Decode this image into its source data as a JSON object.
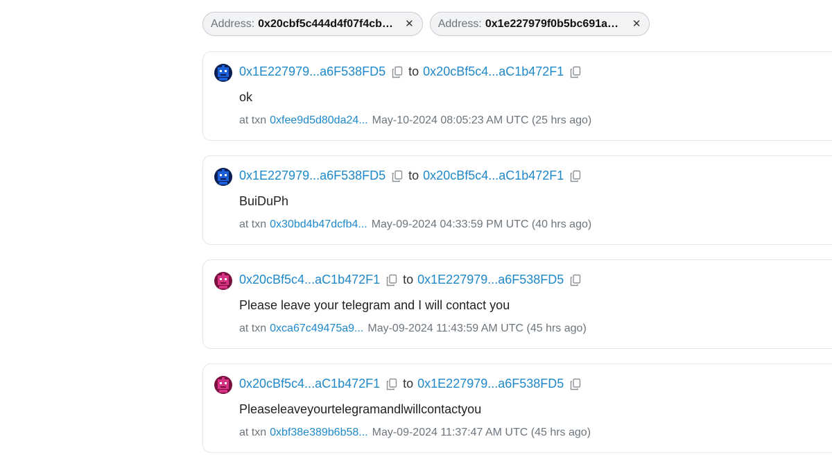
{
  "filters": [
    {
      "label": "Address:",
      "value": "0x20cbf5c444d4f07f4cb5..."
    },
    {
      "label": "Address:",
      "value": "0x1e227979f0b5bc691a7..."
    }
  ],
  "close_glyph": "✕",
  "to_label": "to",
  "txn_prefix": "at txn",
  "messages": [
    {
      "avatar": "blue-robot-avatar",
      "from": "0x1E227979...a6F538FD5",
      "to": "0x20cBf5c4...aC1b472F1",
      "text": "ok",
      "txn": "0xfee9d5d80da24...",
      "timestamp": "May-10-2024 08:05:23 AM UTC (25 hrs ago)"
    },
    {
      "avatar": "blue-robot-avatar",
      "from": "0x1E227979...a6F538FD5",
      "to": "0x20cBf5c4...aC1b472F1",
      "text": "BuiDuPh",
      "txn": "0x30bd4b47dcfb4...",
      "timestamp": "May-09-2024 04:33:59 PM UTC (40 hrs ago)"
    },
    {
      "avatar": "pink-robot-avatar",
      "from": "0x20cBf5c4...aC1b472F1",
      "to": "0x1E227979...a6F538FD5",
      "text": "Please leave your telegram and I will contact you",
      "txn": "0xca67c49475a9...",
      "timestamp": "May-09-2024 11:43:59 AM UTC (45 hrs ago)"
    },
    {
      "avatar": "pink-robot-avatar",
      "from": "0x20cBf5c4...aC1b472F1",
      "to": "0x1E227979...a6F538FD5",
      "text": "Pleaseleaveyourtelegramandlwillcontactyou",
      "txn": "0xbf38e389b6b58...",
      "timestamp": "May-09-2024 11:37:47 AM UTC (45 hrs ago)"
    }
  ],
  "colors": {
    "link": "#1e88c9",
    "muted": "#6c757d",
    "blue_avatar": "#1b5fd9",
    "pink_avatar": "#d63384"
  }
}
